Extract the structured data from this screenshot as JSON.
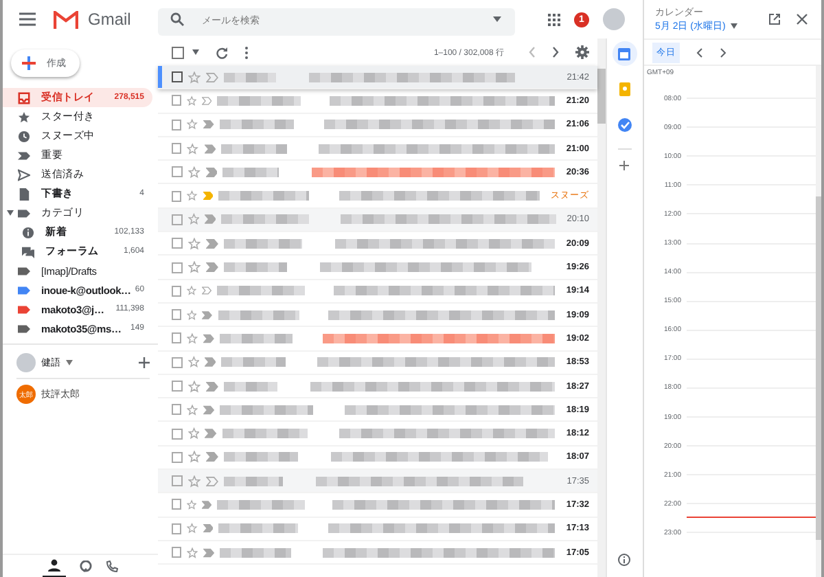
{
  "header": {
    "logo": "Gmail",
    "search_placeholder": "メールを検索",
    "notification_count": "1"
  },
  "compose": "作成",
  "nav": [
    {
      "kind": "inbox",
      "label": "受信トレイ",
      "count": "278,515",
      "selected": true,
      "bold": true
    },
    {
      "kind": "star",
      "label": "スター付き",
      "selected": false,
      "bold": false
    },
    {
      "kind": "clock",
      "label": "スヌーズ中",
      "selected": false,
      "bold": false
    },
    {
      "kind": "important",
      "label": "重要",
      "selected": false,
      "bold": false
    },
    {
      "kind": "send",
      "label": "送信済み",
      "selected": false,
      "bold": false
    },
    {
      "kind": "draft",
      "label": "下書き",
      "count": "4",
      "selected": false,
      "bold": true
    },
    {
      "kind": "label",
      "label": "カテゴリ",
      "selected": false,
      "bold": false,
      "expanded": true,
      "children": [
        {
          "kind": "info",
          "label": "新着",
          "count": "102,133",
          "selected": false,
          "bold": true
        },
        {
          "kind": "forum",
          "label": "フォーラム",
          "count": "1,604",
          "selected": false,
          "bold": true
        }
      ]
    },
    {
      "kind": "label",
      "label": "[Imap]/Drafts",
      "selected": false,
      "bold": false,
      "color": "#616161"
    },
    {
      "kind": "label",
      "label": "inoue-k@outlook…",
      "count": "60",
      "selected": false,
      "bold": true,
      "color": "#4285f4"
    },
    {
      "kind": "label",
      "label": "makoto3@j…",
      "count": "111,398",
      "selected": false,
      "bold": true,
      "color": "#ea4335"
    },
    {
      "kind": "label",
      "label": "makoto35@ms…",
      "count": "149",
      "selected": false,
      "bold": true,
      "color": "#616161"
    }
  ],
  "hangouts": {
    "user": "健語",
    "contacts": [
      {
        "initials": "太郎",
        "name": "技評太郎"
      }
    ]
  },
  "toolbar": {
    "range": "1–100 / 302,008 行",
    "select_all_checked": false
  },
  "emails": [
    {
      "time": "21:42",
      "read": true,
      "focused": true,
      "important": false,
      "marker_filled": false,
      "tinted": false,
      "snoozed": false,
      "checked": false
    },
    {
      "time": "21:20",
      "read": false,
      "focused": false,
      "important": false,
      "marker_filled": false,
      "tinted": false,
      "snoozed": false,
      "checked": false
    },
    {
      "time": "21:06",
      "read": false,
      "focused": false,
      "important": false,
      "marker_filled": true,
      "tinted": false,
      "snoozed": false,
      "checked": false
    },
    {
      "time": "21:00",
      "read": false,
      "focused": false,
      "important": false,
      "marker_filled": true,
      "tinted": false,
      "snoozed": false,
      "checked": false
    },
    {
      "time": "20:36",
      "read": false,
      "focused": false,
      "important": false,
      "marker_filled": true,
      "tinted": true,
      "snoozed": false,
      "checked": false
    },
    {
      "time": "スヌーズ",
      "read": false,
      "focused": false,
      "important": true,
      "marker_filled": true,
      "tinted": false,
      "snoozed": true,
      "checked": false
    },
    {
      "time": "20:10",
      "read": true,
      "focused": false,
      "important": false,
      "marker_filled": true,
      "tinted": false,
      "snoozed": false,
      "checked": false
    },
    {
      "time": "20:09",
      "read": false,
      "focused": false,
      "important": false,
      "marker_filled": true,
      "tinted": false,
      "snoozed": false,
      "checked": false
    },
    {
      "time": "19:26",
      "read": false,
      "focused": false,
      "important": false,
      "marker_filled": true,
      "tinted": false,
      "snoozed": false,
      "checked": false
    },
    {
      "time": "19:14",
      "read": false,
      "focused": false,
      "important": false,
      "marker_filled": false,
      "tinted": false,
      "snoozed": false,
      "checked": false
    },
    {
      "time": "19:09",
      "read": false,
      "focused": false,
      "important": false,
      "marker_filled": true,
      "tinted": false,
      "snoozed": false,
      "checked": false
    },
    {
      "time": "19:02",
      "read": false,
      "focused": false,
      "important": false,
      "marker_filled": true,
      "tinted": true,
      "snoozed": false,
      "checked": false
    },
    {
      "time": "18:53",
      "read": false,
      "focused": false,
      "important": false,
      "marker_filled": true,
      "tinted": false,
      "snoozed": false,
      "checked": false
    },
    {
      "time": "18:27",
      "read": false,
      "focused": false,
      "important": false,
      "marker_filled": true,
      "tinted": false,
      "snoozed": false,
      "checked": false
    },
    {
      "time": "18:19",
      "read": false,
      "focused": false,
      "important": false,
      "marker_filled": true,
      "tinted": false,
      "snoozed": false,
      "checked": false
    },
    {
      "time": "18:12",
      "read": false,
      "focused": false,
      "important": false,
      "marker_filled": true,
      "tinted": false,
      "snoozed": false,
      "checked": false
    },
    {
      "time": "18:07",
      "read": false,
      "focused": false,
      "important": false,
      "marker_filled": true,
      "tinted": false,
      "snoozed": false,
      "checked": false
    },
    {
      "time": "17:35",
      "read": true,
      "focused": false,
      "important": false,
      "marker_filled": false,
      "tinted": false,
      "snoozed": false,
      "checked": false
    },
    {
      "time": "17:32",
      "read": false,
      "focused": false,
      "important": false,
      "marker_filled": true,
      "tinted": false,
      "snoozed": false,
      "checked": false
    },
    {
      "time": "17:13",
      "read": false,
      "focused": false,
      "important": false,
      "marker_filled": true,
      "tinted": false,
      "snoozed": false,
      "checked": false
    },
    {
      "time": "17:05",
      "read": false,
      "focused": false,
      "important": false,
      "marker_filled": true,
      "tinted": false,
      "snoozed": false,
      "checked": false
    }
  ],
  "rail": [
    {
      "kind": "calendar",
      "selected": true
    },
    {
      "kind": "keep",
      "selected": false
    },
    {
      "kind": "tasks",
      "selected": false
    }
  ],
  "calendar": {
    "label": "カレンダー",
    "date": "5月 2日 (水曜日)",
    "today": "今日",
    "timezone": "GMT+09",
    "hours": [
      "08:00",
      "09:00",
      "10:00",
      "11:00",
      "12:00",
      "13:00",
      "14:00",
      "15:00",
      "16:00",
      "17:00",
      "18:00",
      "19:00",
      "20:00",
      "21:00",
      "22:00",
      "23:00"
    ]
  }
}
